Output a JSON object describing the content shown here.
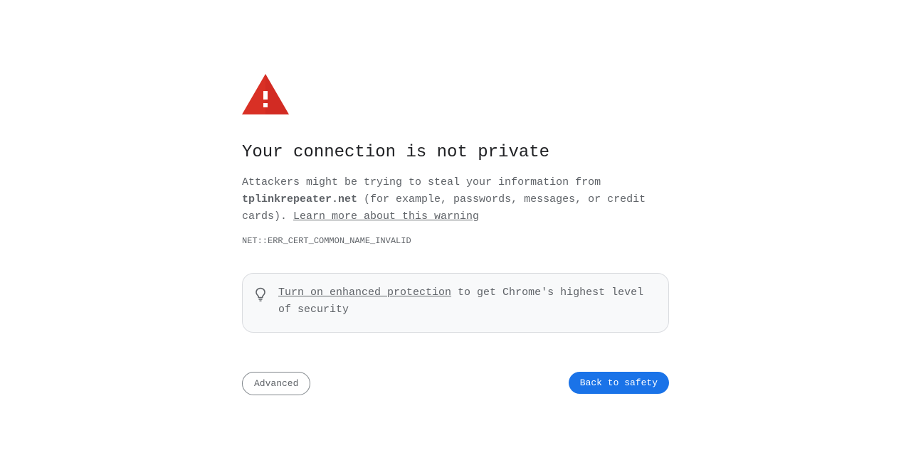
{
  "page": {
    "title": "Your connection is not private",
    "message": {
      "intro": "Attackers might be trying to steal your information from ",
      "domain": "tplinkrepeater.net",
      "details": " (for example, passwords, messages, or credit cards). ",
      "learn_more": "Learn more about this warning"
    },
    "error_code": "NET::ERR_CERT_COMMON_NAME_INVALID",
    "promo": {
      "link_text": "Turn on enhanced protection",
      "rest_text": " to get Chrome's highest level of security"
    },
    "buttons": {
      "advanced": "Advanced",
      "back_to_safety": "Back to safety"
    }
  },
  "colors": {
    "warning_red": "#d93025",
    "primary_blue": "#1a73e8",
    "text_dark": "#202124",
    "text_secondary": "#5f6368"
  },
  "icons": {
    "warning": "warning-triangle-icon",
    "promo": "lightbulb-icon"
  }
}
